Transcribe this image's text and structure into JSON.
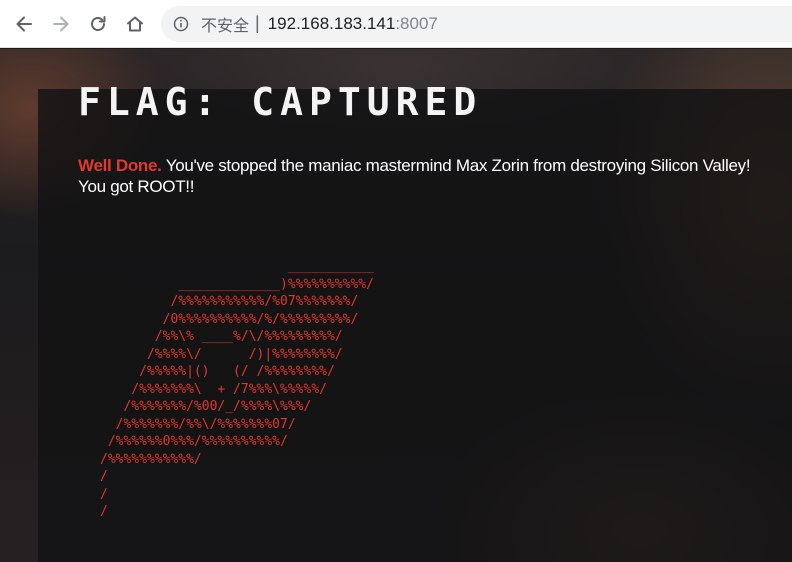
{
  "browser": {
    "security_label": "不安全",
    "url_host": "192.168.183.141",
    "url_port": ":8007"
  },
  "page": {
    "title": "FLAG: CAPTURED",
    "well_done": "Well Done.",
    "message": "You've stopped the maniac mastermind Max Zorin from destroying Silicon Valley!",
    "message_line2": "You got ROOT!!",
    "ascii_art": "                        ___________\n          _____________)%%%%%%%%%%/\n         /%%%%%%%%%%%/%07%%%%%%%/\n        /0%%%%%%%%%%/%/%%%%%%%%%/\n       /%%\\% ____%/\\/%%%%%%%%%/\n      /%%%%\\/      /)|%%%%%%%%/\n     /%%%%%|()   (/ /%%%%%%%%/\n    /%%%%%%%\\  + /7%%%\\%%%%%/\n   /%%%%%%%/%00/_/%%%%\\%%%/\n  /%%%%%%%/%%\\/%%%%%%%07/\n /%%%%%%0%%%/%%%%%%%%%%/\n/%%%%%%%%%%%/\n/\n/\n/"
  },
  "colors": {
    "accent_red": "#e0372d",
    "title_white": "#f4f4f4"
  },
  "icons": {
    "back": "arrow-left-icon",
    "forward": "arrow-right-icon",
    "reload": "reload-icon",
    "home": "home-icon",
    "info": "info-icon"
  }
}
